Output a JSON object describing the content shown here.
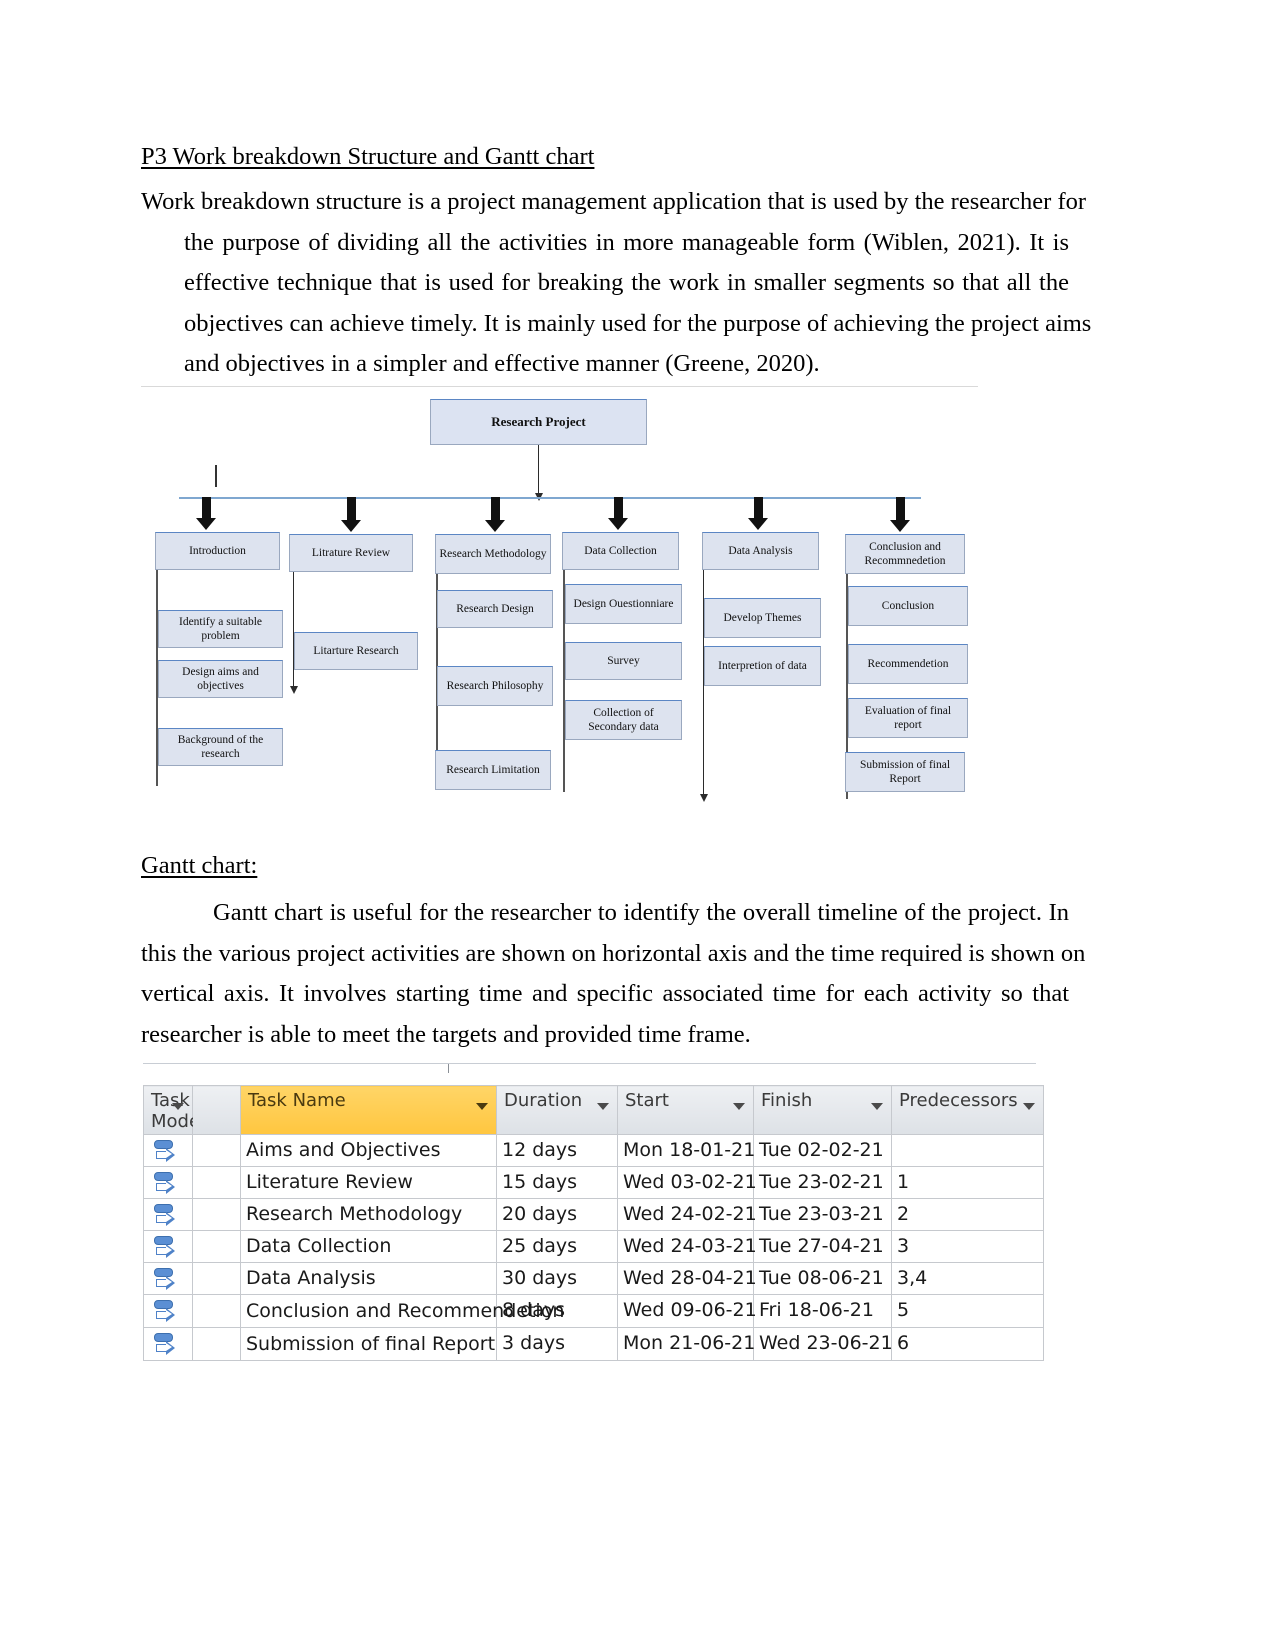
{
  "document": {
    "heading": "P3 Work breakdown Structure and Gantt chart",
    "wbs_paragraph_lines": [
      "Work breakdown structure is a project management application that is used by the researcher for",
      "the purpose of dividing all the activities in more manageable form (Wiblen, 2021). It is",
      "effective technique that is used for breaking the work in smaller segments so that all the",
      "objectives can achieve timely. It is mainly used for the purpose of achieving the project aims",
      "and objectives in a simpler and effective manner (Greene, 2020)."
    ],
    "gantt_heading": "Gantt chart:",
    "gantt_paragraph_lines": [
      "Gantt chart is useful for the researcher to identify the overall timeline of the project. In",
      "this the various project activities are shown on horizontal axis and the time required is shown on",
      "vertical axis. It involves starting time and specific associated time for each activity so that",
      "researcher is able to meet the targets and provided time frame."
    ]
  },
  "wbs": {
    "root": "Research Project",
    "branches": [
      {
        "title": "Introduction",
        "children": [
          "Identify a suitable problem",
          "Design aims and objectives",
          "Background of the research"
        ]
      },
      {
        "title": "Litrature Review",
        "children": [
          "Litarture Research"
        ]
      },
      {
        "title": "Research Methodology",
        "children": [
          "Research Design",
          "Research Philosophy",
          "Research Limitation"
        ]
      },
      {
        "title": "Data Collection",
        "children": [
          "Design Ouestionniare",
          "Survey",
          "Collection of Secondary data"
        ]
      },
      {
        "title": "Data Analysis",
        "children": [
          "Develop Themes",
          "Interpretion of data"
        ]
      },
      {
        "title": "Conclusion and Recommnedetion",
        "children": [
          "Conclusion",
          "Recommendetion",
          "Evaluation of final report",
          "Submission of final Report"
        ]
      }
    ],
    "box_fill": "#dde3ef",
    "box_border": "#9aa8bf",
    "accent_border": "#5b86c4"
  },
  "gantt_table": {
    "columns": [
      "Task Mode",
      "Task Name",
      "Duration",
      "Start",
      "Finish",
      "Predecessors"
    ],
    "highlight_column": "Task Name",
    "highlight_color": "#ffcf5a",
    "rows": [
      {
        "task_name": "Aims and Objectives",
        "duration": "12 days",
        "start": "Mon 18-01-21",
        "finish": "Tue 02-02-21",
        "predecessors": ""
      },
      {
        "task_name": "Literature Review",
        "duration": "15 days",
        "start": "Wed 03-02-21",
        "finish": "Tue 23-02-21",
        "predecessors": "1"
      },
      {
        "task_name": "Research Methodology",
        "duration": "20 days",
        "start": "Wed 24-02-21",
        "finish": "Tue 23-03-21",
        "predecessors": "2"
      },
      {
        "task_name": "Data Collection",
        "duration": "25 days",
        "start": "Wed 24-03-21",
        "finish": "Tue 27-04-21",
        "predecessors": "3"
      },
      {
        "task_name": "Data Analysis",
        "duration": "30 days",
        "start": "Wed 28-04-21",
        "finish": "Tue 08-06-21",
        "predecessors": "3,4"
      },
      {
        "task_name": "Conclusion and Recommendetion",
        "duration": "8 days",
        "start": "Wed 09-06-21",
        "finish": "Fri 18-06-21",
        "predecessors": "5"
      },
      {
        "task_name": "Submission of final Report",
        "duration": "3 days",
        "start": "Mon 21-06-21",
        "finish": "Wed 23-06-21",
        "predecessors": "6"
      }
    ]
  }
}
